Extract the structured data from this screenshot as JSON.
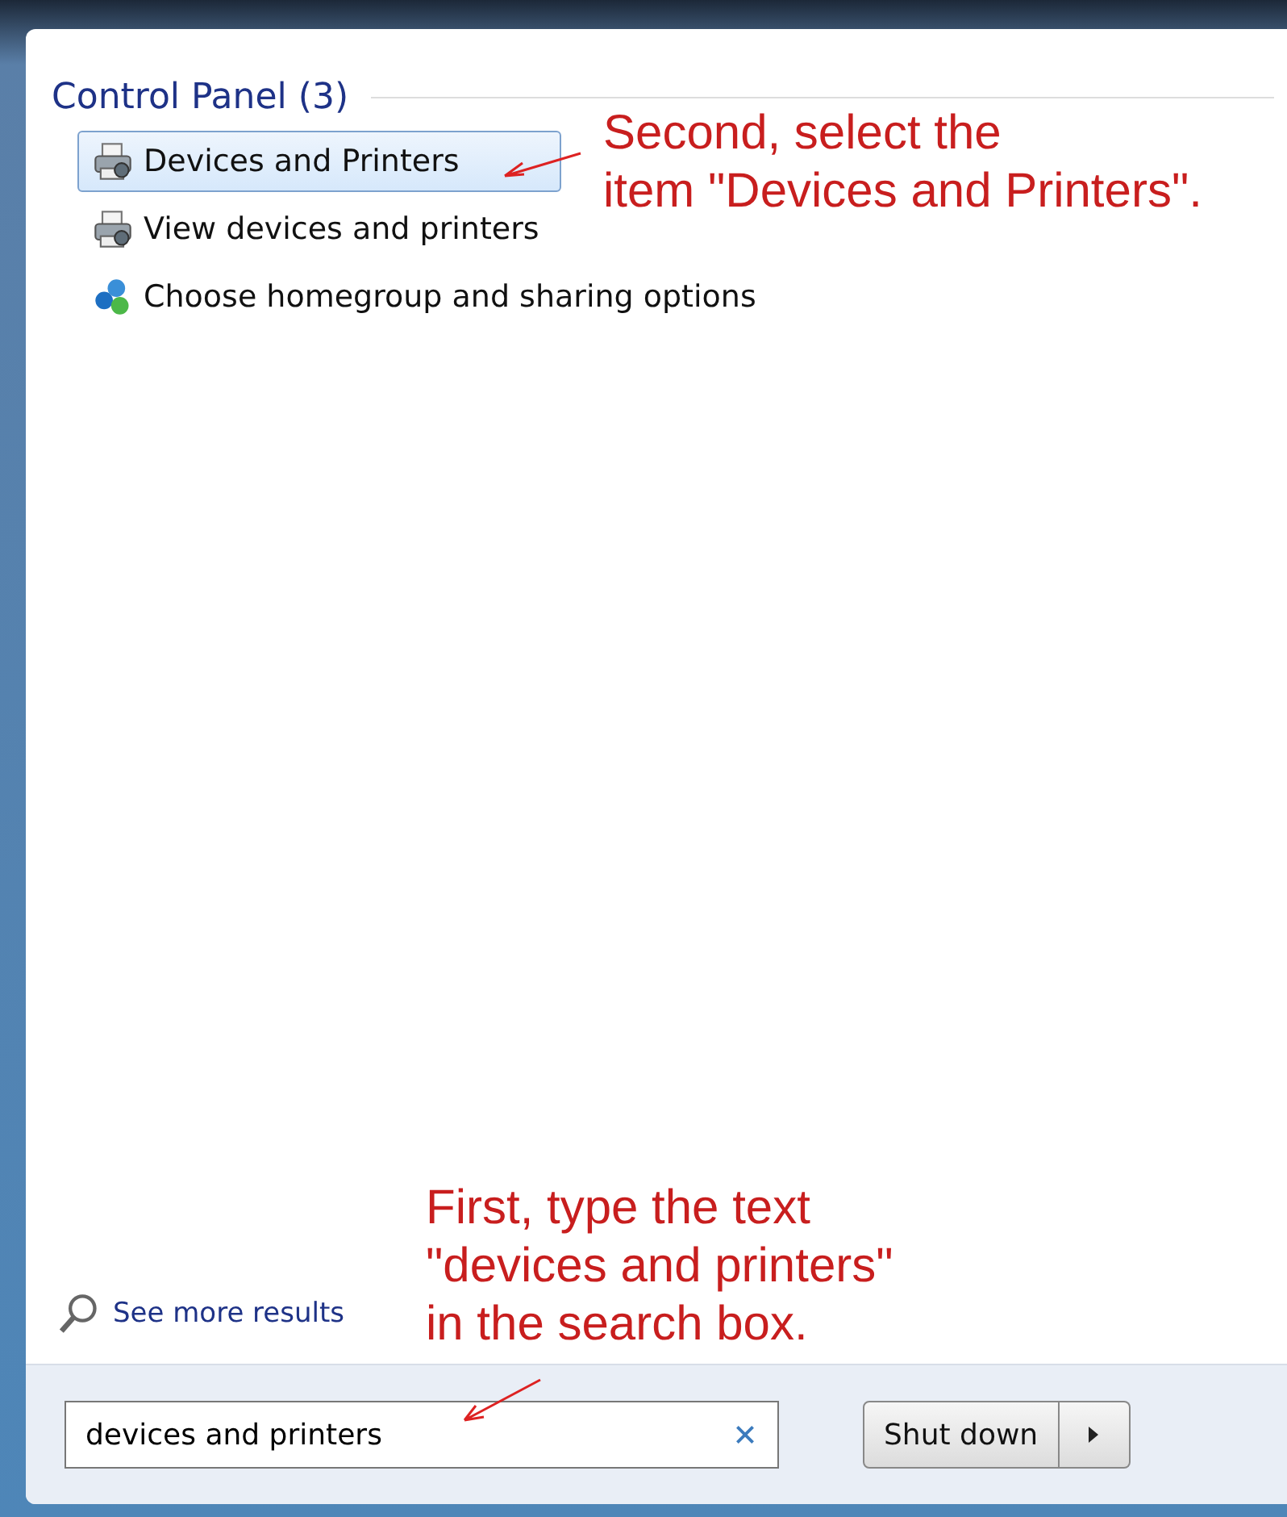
{
  "results": {
    "heading": "Control Panel (3)",
    "items": [
      {
        "label": "Devices and Printers",
        "kind": "printer",
        "selected": true
      },
      {
        "label": "View devices and printers",
        "kind": "printer",
        "selected": false
      },
      {
        "label": "Choose homegroup and sharing options",
        "kind": "homegroup",
        "selected": false
      }
    ]
  },
  "see_more": "See more results",
  "search": {
    "value": "devices and printers"
  },
  "shutdown": {
    "label": "Shut down"
  },
  "select_note": "Second, select the\nitem \"Devices and Printers\".",
  "search_note": "First, type the text\n\"devices and printers\"\nin the search box."
}
